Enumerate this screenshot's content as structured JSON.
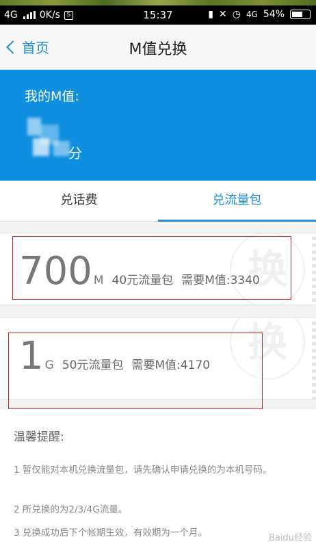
{
  "status_bar": {
    "network": "4G",
    "speed": "0K/s",
    "sim_badge": "S",
    "time": "15:37",
    "network_right": "4G",
    "battery": "54%"
  },
  "nav": {
    "back_label": "首页",
    "title": "M值兑换"
  },
  "banner": {
    "label": "我的M值:",
    "unit": "分"
  },
  "tabs": [
    {
      "label": "兑话费",
      "active": false
    },
    {
      "label": "兑流量包",
      "active": true
    }
  ],
  "products": [
    {
      "quantity": "700",
      "unit": "M",
      "package": "40元流量包",
      "cost": "需要M值:3340",
      "watermark": "换"
    },
    {
      "quantity": "1",
      "unit": "G",
      "package": "50元流量包",
      "cost": "需要M值:4170",
      "watermark": "换"
    }
  ],
  "tips": {
    "title": "温馨提醒:",
    "items": [
      "1 暂仅能对本机兑换流量包，请先确认申请兑换的为本机号码。",
      "2 所兑换的为2/3/4G流量。",
      "3 兑换成功后下个帐期生效，有效期为一个月。"
    ]
  },
  "watermark": "Baidu经验"
}
